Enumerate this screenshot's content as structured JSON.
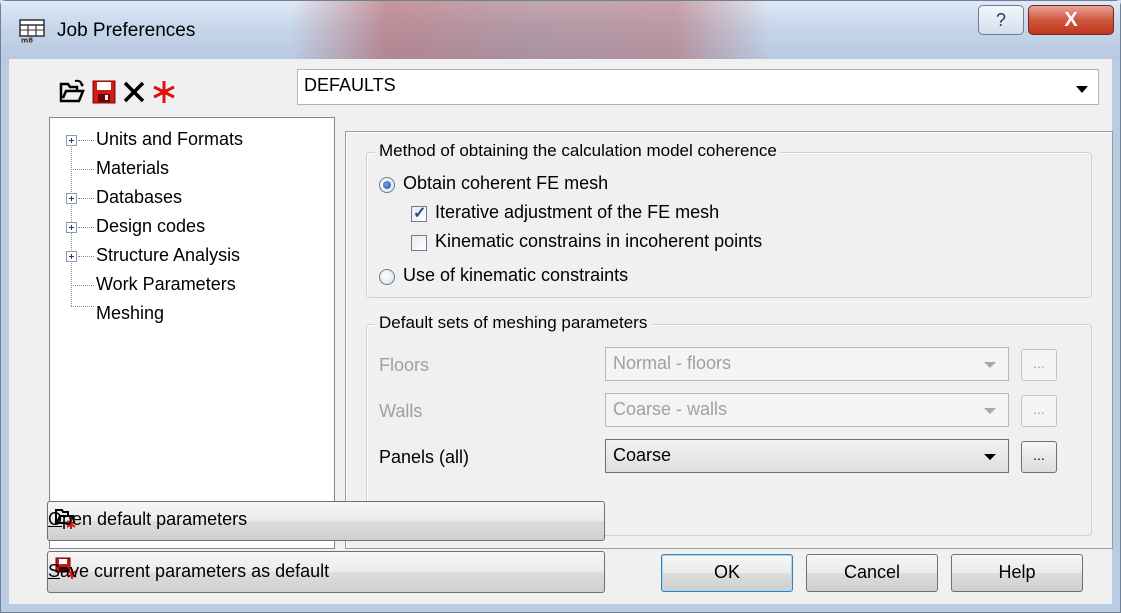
{
  "window": {
    "title": "Job Preferences",
    "help_glyph": "?",
    "close_glyph": "X"
  },
  "toolbar": {
    "open_icon": "open-folder-icon",
    "save_icon": "save-disk-icon",
    "delete_icon": "delete-x-icon",
    "new_icon": "new-star-icon"
  },
  "preset": {
    "value": "DEFAULTS"
  },
  "tree": {
    "items": [
      {
        "label": "Units and Formats",
        "expandable": true
      },
      {
        "label": "Materials",
        "expandable": false
      },
      {
        "label": "Databases",
        "expandable": true
      },
      {
        "label": "Design codes",
        "expandable": true
      },
      {
        "label": "Structure Analysis",
        "expandable": true
      },
      {
        "label": "Work Parameters",
        "expandable": false
      },
      {
        "label": "Meshing",
        "expandable": false,
        "selected": true
      }
    ]
  },
  "coherence": {
    "title": "Method of obtaining the calculation model coherence",
    "radio_mesh": "Obtain coherent FE mesh",
    "check_iterative": "Iterative adjustment of the FE mesh",
    "check_kinematic": "Kinematic constrains in incoherent points",
    "radio_kinematic": "Use of kinematic constraints",
    "radio_mesh_selected": true,
    "check_iterative_checked": true,
    "check_kinematic_checked": false
  },
  "meshing_sets": {
    "title": "Default sets of meshing parameters",
    "floors_label": "Floors",
    "floors_value": "Normal - floors",
    "walls_label": "Walls",
    "walls_value": "Coarse - walls",
    "panels_label": "Panels (all)",
    "panels_value": "Coarse",
    "dots": "..."
  },
  "buttons": {
    "open_default_hotkey": "O",
    "open_default_rest": "pen default parameters",
    "save_default_hotkey": "S",
    "save_default_rest": "ave current parameters as default",
    "ok": "OK",
    "cancel": "Cancel",
    "help": "Help"
  },
  "colors": {
    "accent": "#1a4fa8",
    "close_red": "#c2361d",
    "disabled_text": "#a0a0a0"
  }
}
